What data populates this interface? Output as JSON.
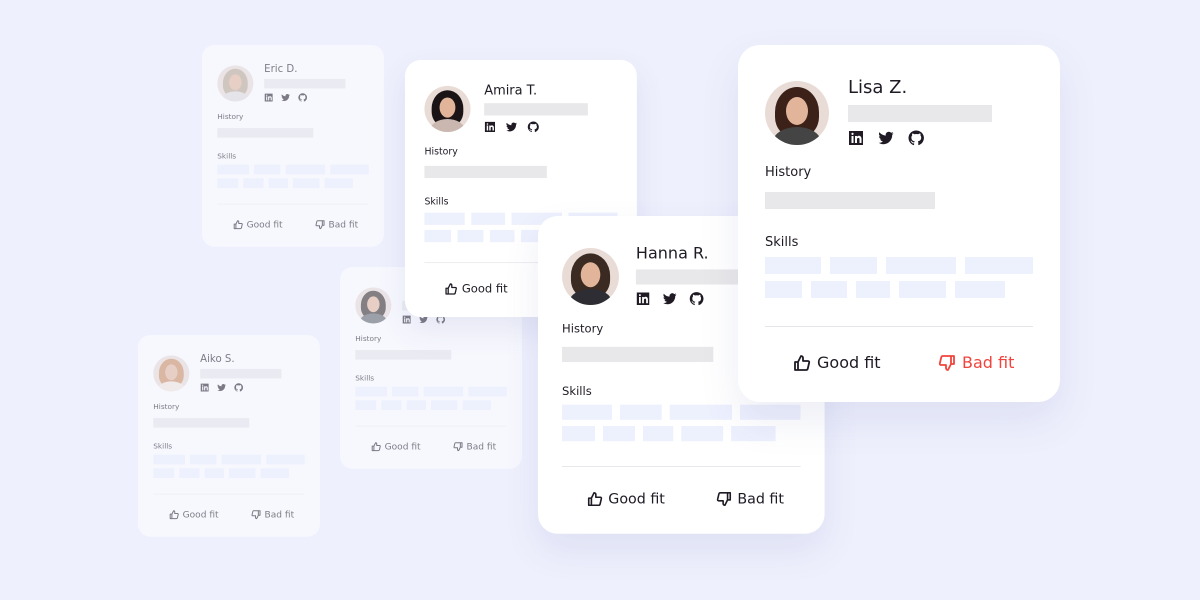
{
  "colors": {
    "background": "#eef0fd",
    "card": "#ffffff",
    "accent_bad": "#f0443c",
    "skill_chip": "#edf0fd",
    "placeholder": "#e8e8ea"
  },
  "labels": {
    "history": "History",
    "skills": "Skills",
    "good_fit": "Good fit",
    "bad_fit": "Bad fit"
  },
  "icons": [
    "linkedin-icon",
    "twitter-icon",
    "github-icon",
    "thumbs-up-icon",
    "thumbs-down-icon"
  ],
  "cards": [
    {
      "id": "eric",
      "name": "Eric D.",
      "hair": "#b9a58f",
      "shirt": "#dcdcdc"
    },
    {
      "id": "aiko",
      "name": "Aiko S.",
      "hair": "#c98a5a",
      "shirt": "#f2e6dc"
    },
    {
      "id": "man",
      "name": "",
      "hair": "#2c231f",
      "shirt": "#5a5f66"
    },
    {
      "id": "amira",
      "name": "Amira T.",
      "hair": "#1b1416",
      "shirt": "#c9b7b0"
    },
    {
      "id": "hanna",
      "name": "Hanna R.",
      "hair": "#3a2a22",
      "shirt": "#2d2d33"
    },
    {
      "id": "lisa",
      "name": "Lisa Z.",
      "hair": "#3b2118",
      "shirt": "#444"
    }
  ]
}
